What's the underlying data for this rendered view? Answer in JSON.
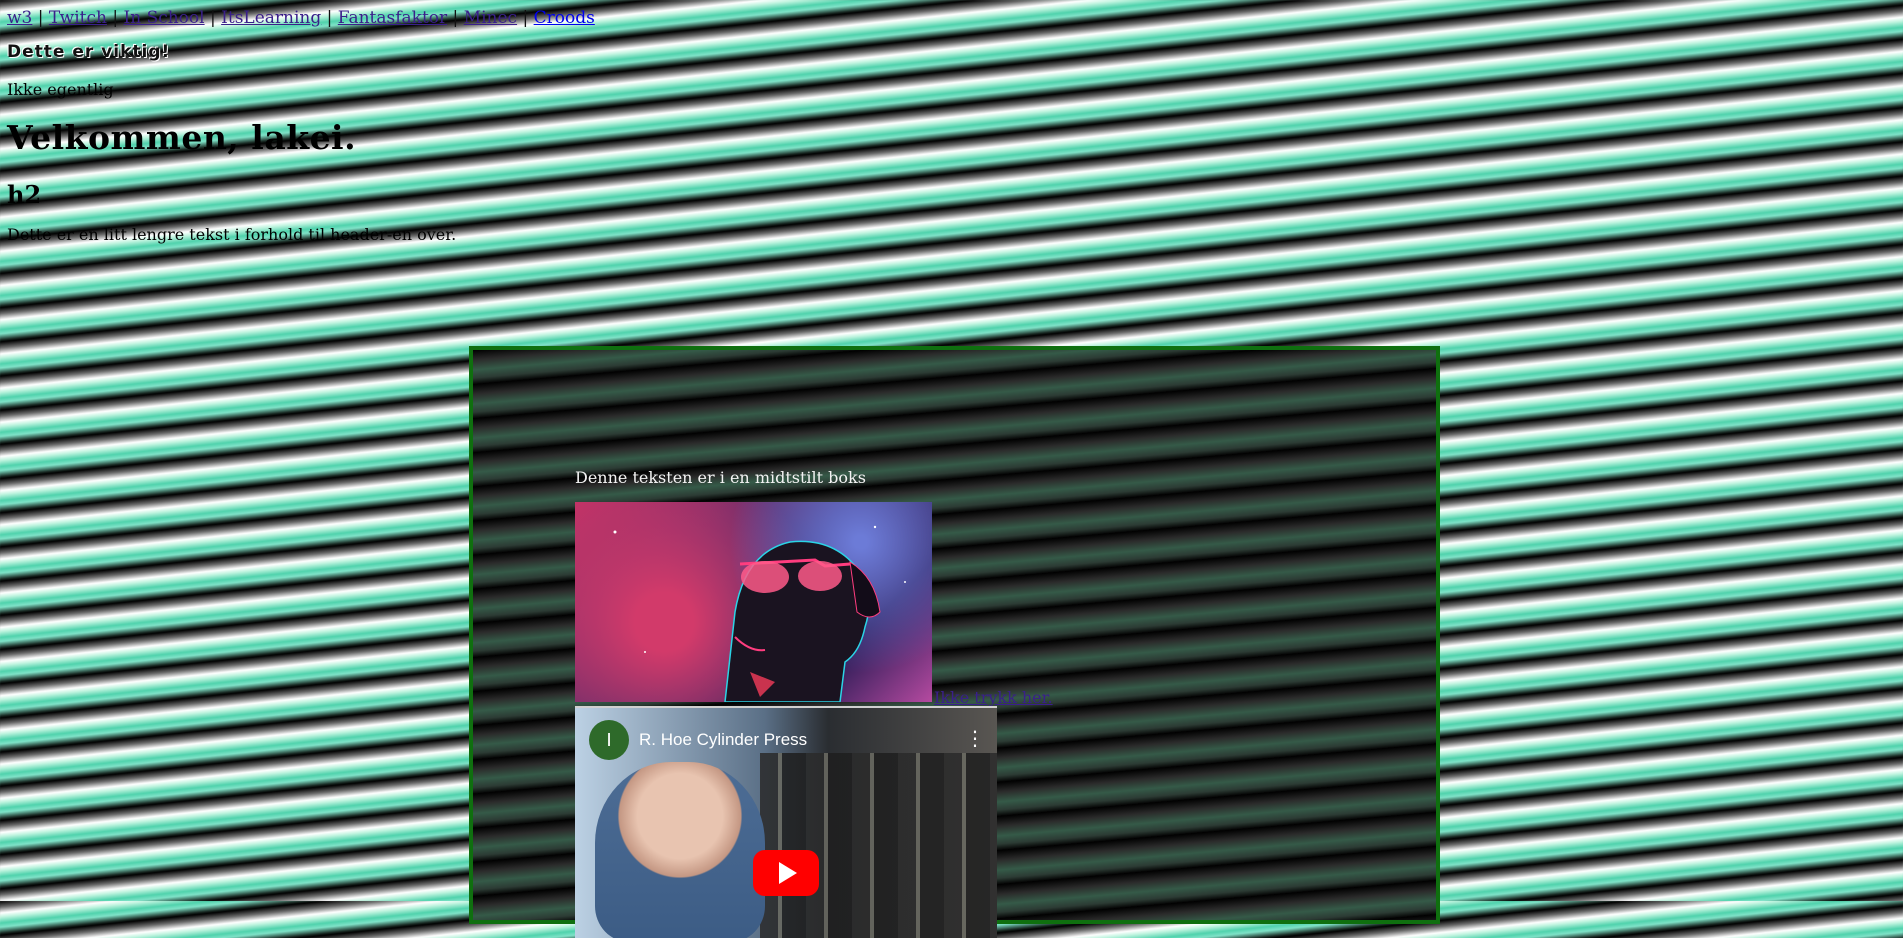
{
  "nav": {
    "links": [
      "w3",
      "Twitch",
      "In School",
      "ItsLearning",
      "Fantasfaktor",
      "Minec",
      "Croods"
    ],
    "separator": "|"
  },
  "headings": {
    "important": "Dette er viktig!",
    "not_really": "Ikke egentlig",
    "welcome": "Velkommen, lakei.",
    "h2": "h2",
    "long_text": "Dette er en litt lengre tekst i forhold til header-en over."
  },
  "box": {
    "text": "Denne teksten er i en midtstilt boks",
    "dont_click_link": "Ikke trykk her.",
    "video": {
      "channel_initial": "I",
      "title": "R. Hoe Cylinder Press",
      "more_icon": "more-vertical-icon",
      "play_icon": "youtube-play-icon"
    }
  },
  "colors": {
    "box_border": "#0f6f0f",
    "link_visited": "#3a1f8a",
    "link": "#0000ee",
    "play_button": "#ff0000"
  }
}
